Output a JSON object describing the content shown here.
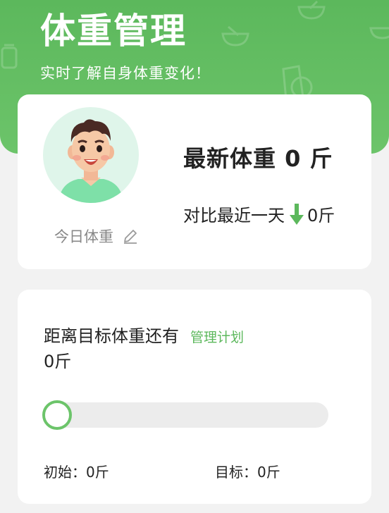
{
  "header": {
    "title": "体重管理",
    "subtitle": "实时了解自身体重变化！",
    "accent": "#5cb85c"
  },
  "summary": {
    "today_label": "今日体重",
    "edit_icon": "pencil-icon",
    "latest_prefix": "最新体重",
    "latest_value": "0",
    "latest_unit": "斤",
    "compare_label": "对比最近一天",
    "compare_trend": "down",
    "compare_value": "0斤"
  },
  "goal": {
    "title": "距离目标体重还有",
    "plan_link": "管理计划",
    "remaining": "0斤",
    "progress": 0,
    "initial_label": "初始：0斤",
    "target_label": "目标：0斤"
  }
}
